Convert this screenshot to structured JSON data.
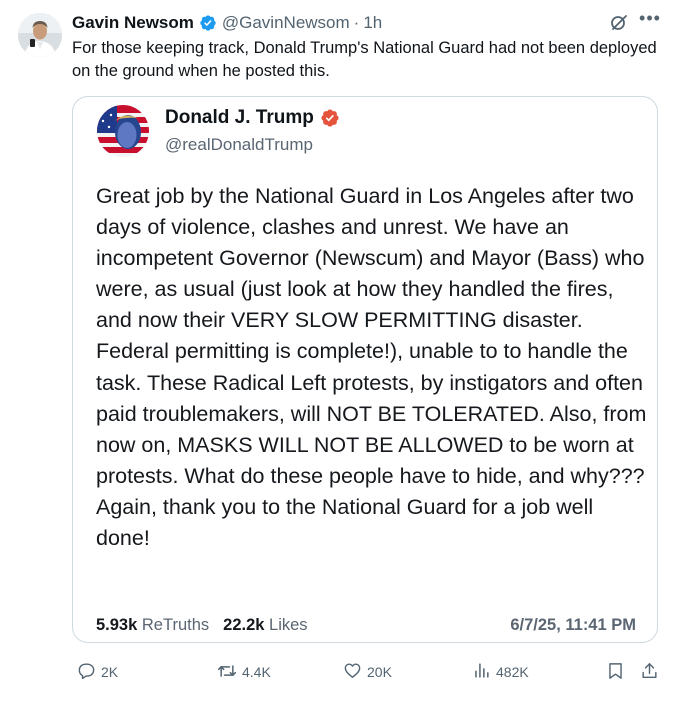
{
  "tweet": {
    "author_name": "Gavin Newsom",
    "handle": "@GavinNewsom",
    "separator": "·",
    "time": "1h",
    "text": "For those keeping track, Donald Trump's National Guard had not been deployed on the ground when he posted this.",
    "verified_color": "#1d9bf0",
    "icons": {
      "grok": "grok-icon",
      "more": "more-dots-icon"
    }
  },
  "quoted": {
    "author_name": "Donald J. Trump",
    "handle": "@realDonaldTrump",
    "badge_color": "#e5533d",
    "text": "Great job by the National Guard in Los Angeles after two days of violence, clashes and unrest. We have an incompetent Governor (Newscum) and Mayor (Bass) who were, as usual (just look at how they handled the fires, and now their VERY SLOW PERMITTING disaster. Federal permitting is complete!), unable to to handle the task. These Radical Left protests, by instigators and often paid troublemakers, will NOT BE TOLERATED. Also, from now on, MASKS WILL NOT BE ALLOWED to be worn at protests. What do these people have to hide, and why??? Again, thank you to the National Guard for a job well done!",
    "retruths_count": "5.93k",
    "retruths_label": "ReTruths",
    "likes_count": "22.2k",
    "likes_label": "Likes",
    "datetime": "6/7/25, 11:41 PM"
  },
  "actions": {
    "replies": "2K",
    "reposts": "4.4K",
    "likes": "20K",
    "views": "482K",
    "icons": [
      "reply-icon",
      "repost-icon",
      "like-icon",
      "views-icon",
      "bookmark-icon",
      "share-icon"
    ]
  }
}
